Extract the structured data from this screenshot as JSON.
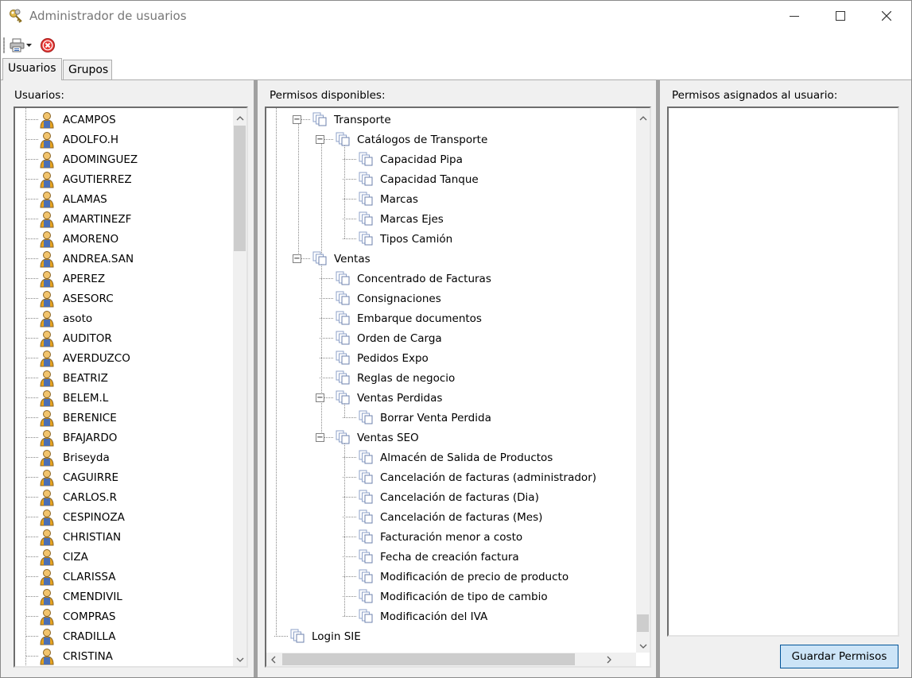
{
  "window": {
    "title": "Administrador de usuarios",
    "app_icon": "keys-icon"
  },
  "toolbar": {
    "print_icon": "printer-icon",
    "close_icon": "close-red-icon"
  },
  "tabs": [
    {
      "label": "Usuarios",
      "active": true
    },
    {
      "label": "Grupos",
      "active": false
    }
  ],
  "users_panel": {
    "label": "Usuarios:",
    "items": [
      "ACAMPOS",
      "ADOLFO.H",
      "ADOMINGUEZ",
      "AGUTIERREZ",
      "ALAMAS",
      "AMARTINEZF",
      "AMORENO",
      "ANDREA.SAN",
      "APEREZ",
      "ASESORC",
      "asoto",
      "AUDITOR",
      "AVERDUZCO",
      "BEATRIZ",
      "BELEM.L",
      "BERENICE",
      "BFAJARDO",
      "Briseyda",
      "CAGUIRRE",
      "CARLOS.R",
      "CESPINOZA",
      "CHRISTIAN",
      "CIZA",
      "CLARISSA",
      "CMENDIVIL",
      "COMPRAS",
      "CRADILLA",
      "CRISTINA"
    ]
  },
  "permissions_panel": {
    "label": "Permisos disponibles:",
    "tree": [
      {
        "label": "Transporte",
        "level": 1,
        "expander": "−"
      },
      {
        "label": "Catálogos de Transporte",
        "level": 2,
        "expander": "−"
      },
      {
        "label": "Capacidad Pipa",
        "level": 3
      },
      {
        "label": "Capacidad Tanque",
        "level": 3
      },
      {
        "label": "Marcas",
        "level": 3
      },
      {
        "label": "Marcas Ejes",
        "level": 3
      },
      {
        "label": "Tipos Camión",
        "level": 3
      },
      {
        "label": "Ventas",
        "level": 1,
        "expander": "−"
      },
      {
        "label": "Concentrado de Facturas",
        "level": 2
      },
      {
        "label": "Consignaciones",
        "level": 2
      },
      {
        "label": "Embarque documentos",
        "level": 2
      },
      {
        "label": "Orden de Carga",
        "level": 2
      },
      {
        "label": "Pedidos Expo",
        "level": 2
      },
      {
        "label": "Reglas de negocio",
        "level": 2
      },
      {
        "label": "Ventas Perdidas",
        "level": 2,
        "expander": "−"
      },
      {
        "label": "Borrar Venta Perdida",
        "level": 3
      },
      {
        "label": "Ventas SEO",
        "level": 2,
        "expander": "−"
      },
      {
        "label": "Almacén de Salida de Productos",
        "level": 3
      },
      {
        "label": "Cancelación de facturas (administrador)",
        "level": 3
      },
      {
        "label": "Cancelación de facturas (Dia)",
        "level": 3
      },
      {
        "label": "Cancelación de facturas (Mes)",
        "level": 3
      },
      {
        "label": "Facturación menor a costo",
        "level": 3
      },
      {
        "label": "Fecha de creación factura",
        "level": 3
      },
      {
        "label": "Modificación de precio de producto",
        "level": 3
      },
      {
        "label": "Modificación de tipo de cambio",
        "level": 3
      },
      {
        "label": "Modificación del IVA",
        "level": 3
      },
      {
        "label": "Login SIE",
        "level": 0
      }
    ]
  },
  "assigned_panel": {
    "label": "Permisos asignados al usuario:",
    "items": []
  },
  "save_button": {
    "label": "Guardar Permisos"
  },
  "colors": {
    "accent_button": "#cce4f7",
    "close_icon": "#e53935"
  }
}
